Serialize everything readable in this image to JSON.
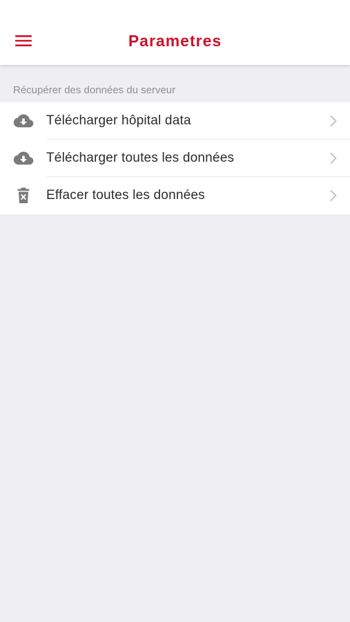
{
  "colors": {
    "accent": "#d0112b",
    "icon": "#7a7a7a",
    "background": "#eeeef3"
  },
  "header": {
    "title": "Parametres",
    "menu_icon": "hamburger-menu-icon"
  },
  "section": {
    "label": "Récupérer des données du serveur"
  },
  "items": [
    {
      "label": "Télécharger hôpital data",
      "icon": "cloud-download-icon"
    },
    {
      "label": "Télécharger toutes les données",
      "icon": "cloud-download-icon"
    },
    {
      "label": "Effacer toutes les données",
      "icon": "trash-delete-icon"
    }
  ]
}
